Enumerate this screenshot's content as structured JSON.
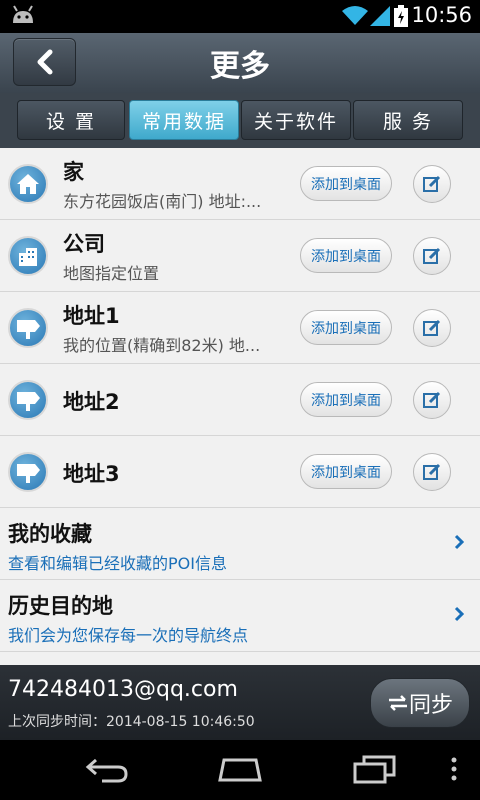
{
  "status": {
    "time": "10:56"
  },
  "header": {
    "title": "更多"
  },
  "tabs": [
    {
      "label": "设 置"
    },
    {
      "label": "常用数据"
    },
    {
      "label": "关于软件"
    },
    {
      "label": "服 务"
    }
  ],
  "places": [
    {
      "name": "家",
      "detail": "东方花园饭店(南门) 地址:...",
      "icon": "home-icon",
      "add_label": "添加到桌面"
    },
    {
      "name": "公司",
      "detail": "地图指定位置",
      "icon": "building-icon",
      "add_label": "添加到桌面"
    },
    {
      "name": "地址1",
      "detail": "我的位置(精确到82米) 地...",
      "icon": "signpost-icon",
      "add_label": "添加到桌面"
    },
    {
      "name": "地址2",
      "detail": "",
      "icon": "signpost-icon",
      "add_label": "添加到桌面"
    },
    {
      "name": "地址3",
      "detail": "",
      "icon": "signpost-icon",
      "add_label": "添加到桌面"
    }
  ],
  "links": [
    {
      "title": "我的收藏",
      "desc": "查看和编辑已经收藏的POI信息"
    },
    {
      "title": "历史目的地",
      "desc": "我们会为您保存每一次的导航终点"
    }
  ],
  "sync": {
    "account": "742484013@qq.com",
    "last_sync": "上次同步时间：2014-08-15 10:46:50",
    "button_label": "同步"
  },
  "colors": {
    "accent": "#3fa9cc",
    "link": "#1a6fb8",
    "icon": "#2a78b5"
  }
}
